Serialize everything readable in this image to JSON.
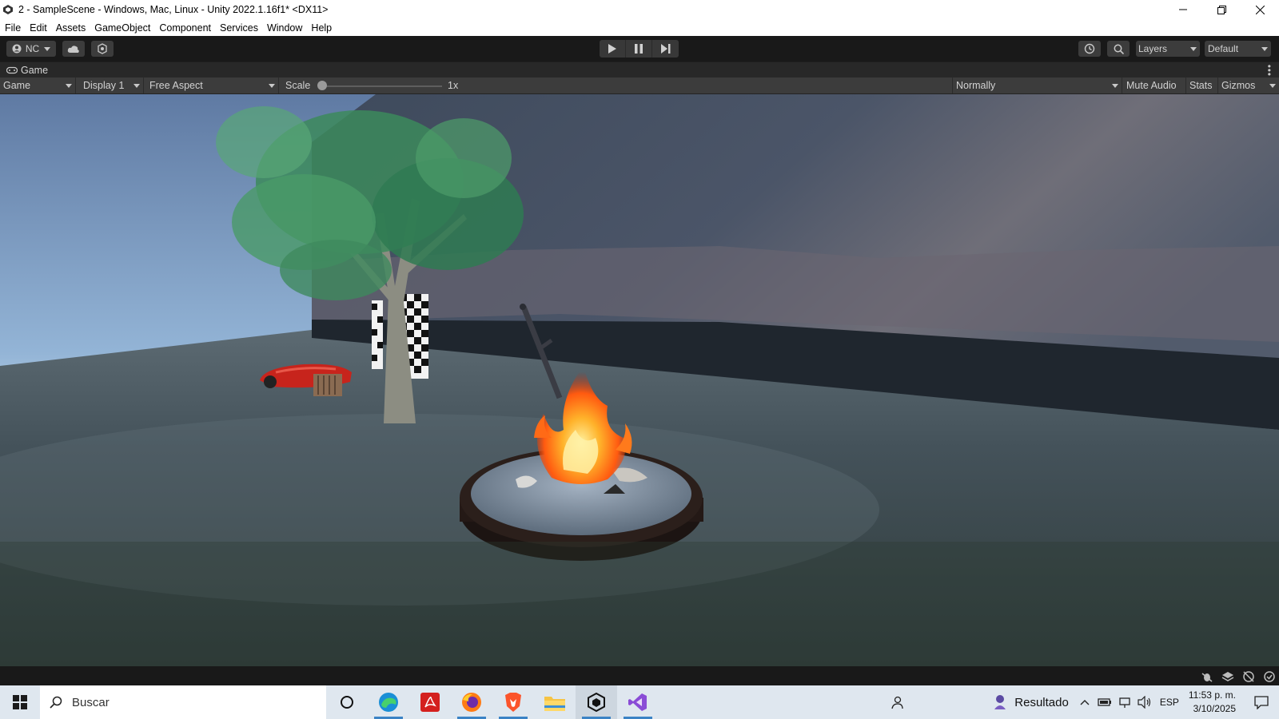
{
  "window": {
    "title": "2 - SampleScene - Windows, Mac, Linux - Unity 2022.1.16f1* <DX11>",
    "icon": "unity-icon",
    "controls": [
      "minimize-icon",
      "restore-icon",
      "close-icon"
    ]
  },
  "menu": {
    "items": [
      "File",
      "Edit",
      "Assets",
      "GameObject",
      "Component",
      "Services",
      "Window",
      "Help"
    ]
  },
  "toolbar": {
    "account_label": "NC",
    "layers_label": "Layers",
    "layout_label": "Default"
  },
  "tab": {
    "label": "Game"
  },
  "gamebar": {
    "view_mode": "Game",
    "display": "Display 1",
    "aspect": "Free Aspect",
    "scale_label": "Scale",
    "scale_value": "1x",
    "scale_fraction": 0.0,
    "play_mode": "Normally",
    "mute_audio": "Mute Audio",
    "stats": "Stats",
    "gizmos": "Gizmos"
  },
  "taskbar": {
    "search_placeholder": "Buscar",
    "apps": [
      "cortana-icon",
      "edge-icon",
      "acrobat-icon",
      "firefox-icon",
      "brave-icon",
      "file-explorer-icon",
      "unity-hub-icon",
      "visual-studio-icon"
    ],
    "weather_label": "Resultado",
    "language": "ESP",
    "time": "11:53 p. m.",
    "date": "3/10/2025"
  },
  "colors": {
    "editor_bg": "#191919",
    "panel_bg": "#3c3c3c",
    "taskbar_bg": "#dfe7ef",
    "accent": "#3b83c5"
  }
}
